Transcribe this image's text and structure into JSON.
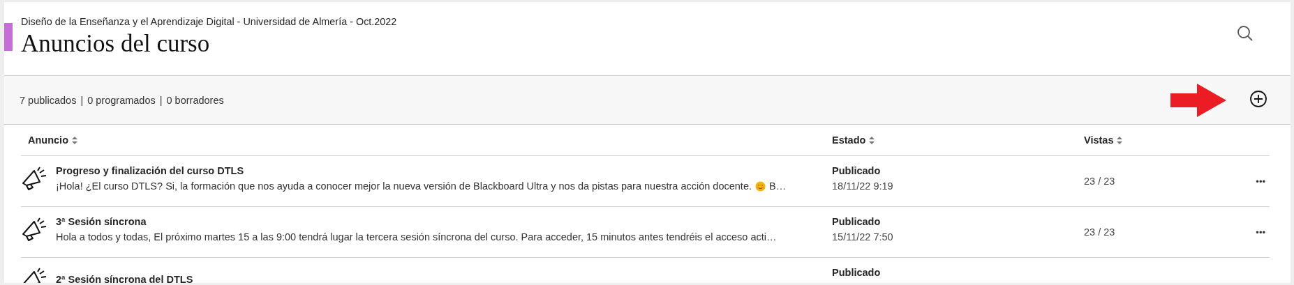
{
  "course_title": "Diseño de la Enseñanza y el Aprendizaje Digital - Universidad de Almería - Oct.2022",
  "page_title": "Anuncios del curso",
  "summary": {
    "published": "7 publicados",
    "separator_1": "|",
    "scheduled": "0 programados",
    "separator_2": "|",
    "drafts": "0 borradores"
  },
  "columns": [
    {
      "label": "Anuncio"
    },
    {
      "label": "Estado"
    },
    {
      "label": "Vistas"
    }
  ],
  "rows": [
    {
      "title": "Progreso y finalización del curso DTLS",
      "body": [
        {
          "kind": "text",
          "text": "¡Hola! ¿El curso DTLS?  Si, la formación que nos ayuda a conocer mejor la nueva versión de Blackboard Ultra y nos da pistas para nuestra acción docente."
        },
        {
          "kind": "emoji"
        },
        {
          "kind": "text",
          "text": "B…"
        }
      ],
      "status": "Publicado",
      "date": "18/11/22 9:19",
      "views": "23 / 23",
      "menu": "•••"
    },
    {
      "title": "3ª Sesión síncrona",
      "body": [
        {
          "kind": "text",
          "text": "Hola a todos y todas,  El próximo martes 15 a las 9:00 tendrá lugar la tercera sesión síncrona del curso.  Para acceder, 15 minutos antes tendréis el acceso acti…"
        }
      ],
      "status": "Publicado",
      "date": "15/11/22 7:50",
      "views": "23 / 23",
      "menu": "•••"
    },
    {
      "title": "2ª Sesión síncrona del DTLS",
      "status": "Publicado"
    }
  ]
}
